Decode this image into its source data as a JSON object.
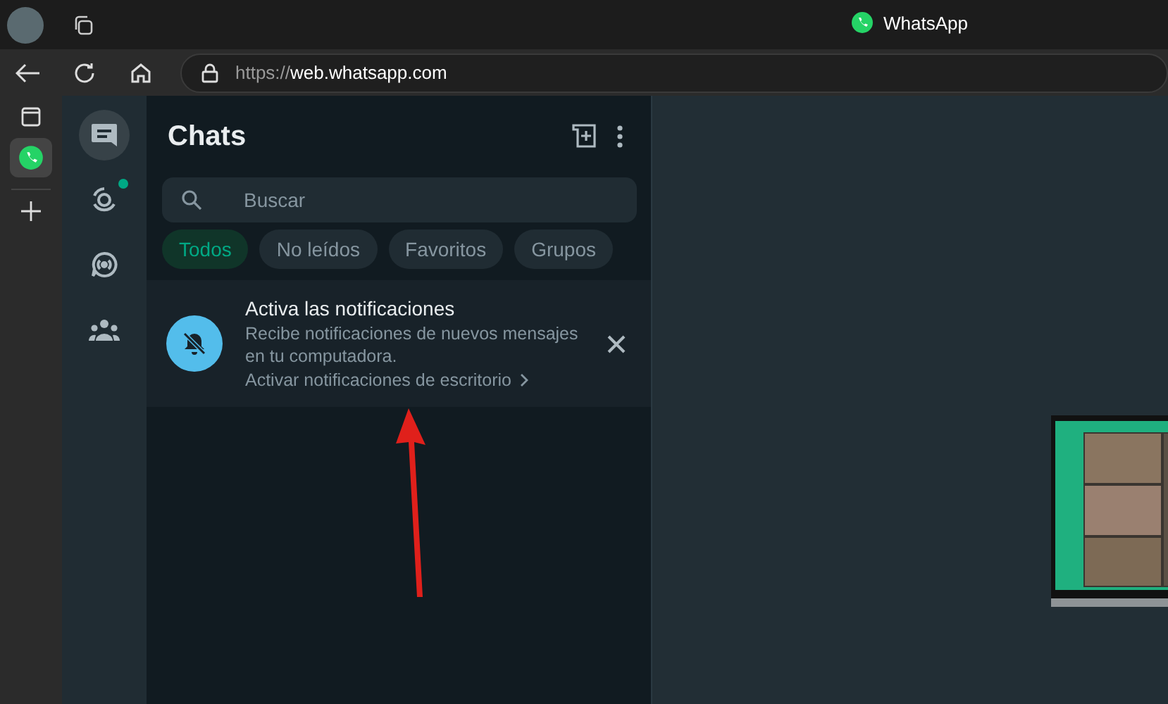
{
  "browser": {
    "title": "WhatsApp",
    "url_scheme": "https://",
    "url_host": "web.whatsapp.com",
    "tabs": [
      {
        "kind": "whatsapp",
        "selected": true
      }
    ]
  },
  "nav": [
    {
      "kind": "chats",
      "selected": true,
      "unread": false
    },
    {
      "kind": "status",
      "selected": false,
      "unread": true
    },
    {
      "kind": "channels",
      "selected": false,
      "unread": false
    },
    {
      "kind": "communities",
      "selected": false,
      "unread": false
    }
  ],
  "chats": {
    "title": "Chats",
    "search": {
      "placeholder": "Buscar"
    },
    "filters": [
      {
        "label": "Todos",
        "selected": true
      },
      {
        "label": "No leídos",
        "selected": false
      },
      {
        "label": "Favoritos",
        "selected": false
      },
      {
        "label": "Grupos",
        "selected": false
      }
    ],
    "banner": {
      "title": "Activa las notificaciones",
      "text": "Recibe notificaciones de nuevos mensajes en tu computadora.",
      "link": "Activar notificaciones de escritorio"
    }
  }
}
